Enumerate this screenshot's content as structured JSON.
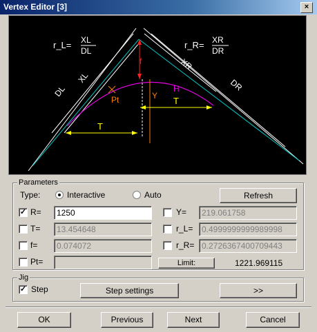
{
  "window": {
    "title": "Vertex Editor [3]",
    "close_glyph": "×"
  },
  "canvas": {
    "formula_left": {
      "lhs": "r_L=",
      "num": "XL",
      "den": "DL"
    },
    "formula_right": {
      "lhs": "r_R=",
      "num": "XR",
      "den": "DR"
    },
    "labels": {
      "DL": "DL",
      "XL": "XL",
      "XR": "XR",
      "DR": "DR",
      "f": "f",
      "Y": "Y",
      "H": "H",
      "Pt": "Pt",
      "T_left": "T",
      "T_right": "T"
    },
    "colors": {
      "background": "#000000",
      "lines": "#ffffff",
      "tangent": "#00c8c8",
      "curve": "#e000e0",
      "dimension": "#ffff00",
      "f_line": "#ff2020",
      "y_line": "#ff8000"
    }
  },
  "parameters": {
    "group_label": "Parameters",
    "type_label": "Type:",
    "interactive_label": "Interactive",
    "auto_label": "Auto",
    "selected_type": "Interactive",
    "refresh_label": "Refresh",
    "limit_label": "Limit:",
    "limit_value": "1221.969115",
    "fields": {
      "R": {
        "label": "R=",
        "value": "1250",
        "checked": true
      },
      "T": {
        "label": "T=",
        "value": "13.454648",
        "checked": false
      },
      "f": {
        "label": "f=",
        "value": "0.074072",
        "checked": false
      },
      "Pt": {
        "label": "Pt=",
        "value": "",
        "checked": false
      },
      "Y": {
        "label": "Y=",
        "value": "219.061758",
        "checked": false
      },
      "r_L": {
        "label": "r_L=",
        "value": "0.4999999999989998",
        "checked": false
      },
      "r_R": {
        "label": "r_R=",
        "value": "0.2726367400709443",
        "checked": false
      }
    },
    "check_glyph": "✓"
  },
  "jig": {
    "group_label": "Jig",
    "step_label": "Step",
    "step_checked": true,
    "step_settings_label": "Step settings",
    "forward_label": ">>"
  },
  "footer": {
    "ok_label": "OK",
    "previous_label": "Previous",
    "next_label": "Next",
    "cancel_label": "Cancel"
  }
}
